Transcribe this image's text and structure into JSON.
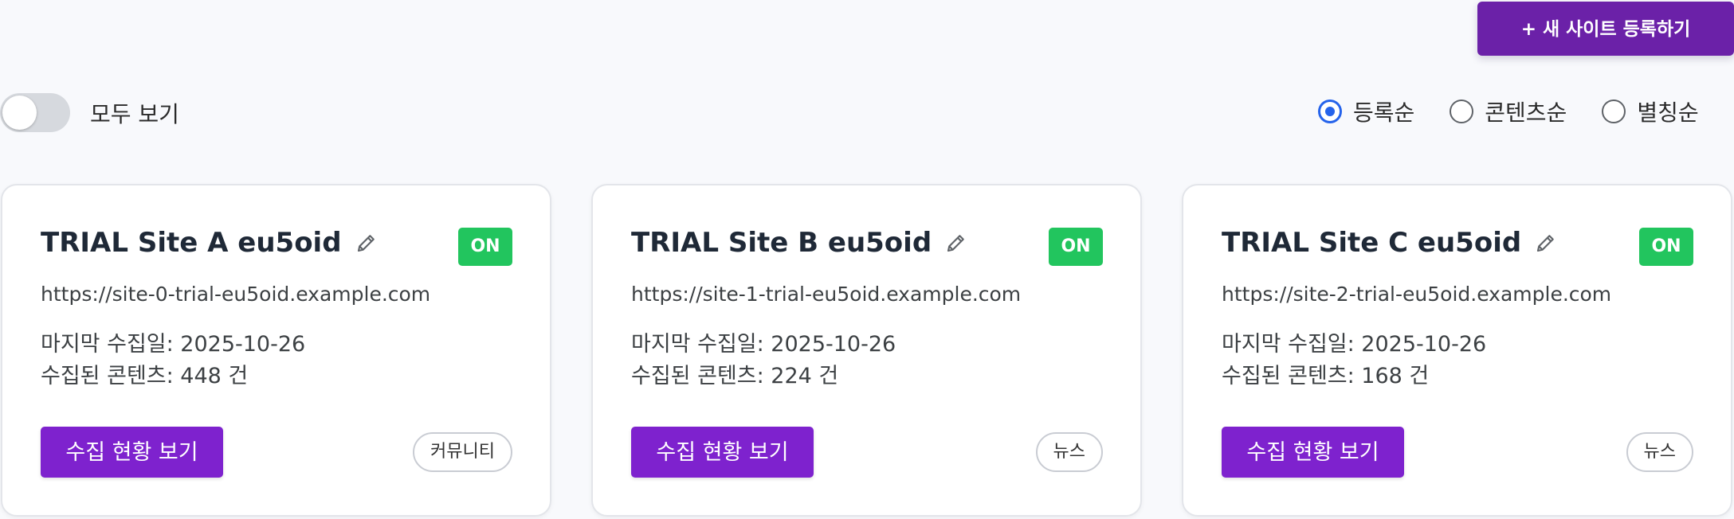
{
  "header": {
    "register_button": "+ 새 사이트 등록하기"
  },
  "filter": {
    "show_all_label": "모두 보기",
    "show_all_enabled": false
  },
  "sort": {
    "options": [
      {
        "label": "등록순",
        "selected": true
      },
      {
        "label": "콘텐츠순",
        "selected": false
      },
      {
        "label": "별칭순",
        "selected": false
      }
    ]
  },
  "colors": {
    "primary_purple": "#7e22ce",
    "status_on_green": "#22c55e",
    "radio_selected_blue": "#2563eb"
  },
  "sites": [
    {
      "name": "TRIAL Site A eu5oid",
      "status": "ON",
      "url": "https://site-0-trial-eu5oid.example.com",
      "last_collected": "마지막 수집일: 2025-10-26",
      "content_count": "수집된 콘텐츠: 448 건",
      "action_label": "수집 현황 보기",
      "category": "커뮤니티",
      "edit_icon": "pencil-icon"
    },
    {
      "name": "TRIAL Site B eu5oid",
      "status": "ON",
      "url": "https://site-1-trial-eu5oid.example.com",
      "last_collected": "마지막 수집일: 2025-10-26",
      "content_count": "수집된 콘텐츠: 224 건",
      "action_label": "수집 현황 보기",
      "category": "뉴스",
      "edit_icon": "pencil-icon"
    },
    {
      "name": "TRIAL Site C eu5oid",
      "status": "ON",
      "url": "https://site-2-trial-eu5oid.example.com",
      "last_collected": "마지막 수집일: 2025-10-26",
      "content_count": "수집된 콘텐츠: 168 건",
      "action_label": "수집 현황 보기",
      "category": "뉴스",
      "edit_icon": "pencil-icon"
    }
  ]
}
